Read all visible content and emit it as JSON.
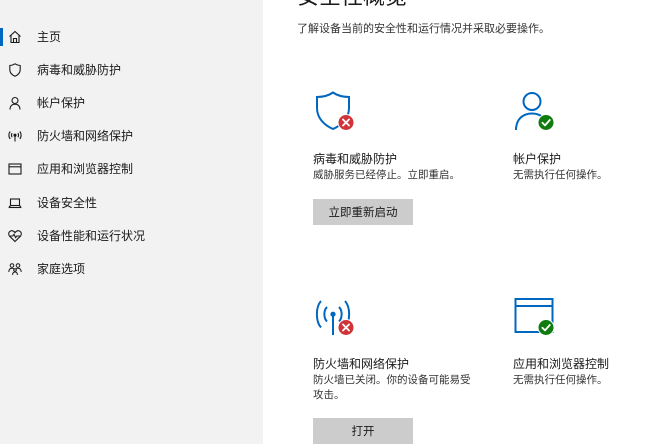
{
  "sidebar": {
    "items": [
      {
        "label": "主页",
        "icon": "home-icon",
        "selected": true
      },
      {
        "label": "病毒和威胁防护",
        "icon": "shield-icon"
      },
      {
        "label": "帐户保护",
        "icon": "person-icon"
      },
      {
        "label": "防火墙和网络保护",
        "icon": "wifi-antenna-icon"
      },
      {
        "label": "应用和浏览器控制",
        "icon": "browser-window-icon"
      },
      {
        "label": "设备安全性",
        "icon": "laptop-icon"
      },
      {
        "label": "设备性能和运行状况",
        "icon": "heart-pulse-icon"
      },
      {
        "label": "家庭选项",
        "icon": "family-icon"
      }
    ]
  },
  "main": {
    "title": "安全性概览",
    "subtitle": "了解设备当前的安全性和运行情况并采取必要操作。",
    "tiles": [
      {
        "title": "病毒和威胁防护",
        "desc": "威胁服务已经停止。立即重启。",
        "button": "立即重新启动",
        "icon": "shield-icon",
        "status": "error"
      },
      {
        "title": "帐户保护",
        "desc": "无需执行任何操作。",
        "icon": "person-icon",
        "status": "ok"
      },
      {
        "title": "防火墙和网络保护",
        "desc": "防火墙已关闭。你的设备可能易受攻击。",
        "button": "打开",
        "icon": "wifi-antenna-icon",
        "status": "error"
      },
      {
        "title": "应用和浏览器控制",
        "desc": "无需执行任何操作。",
        "icon": "browser-window-icon",
        "status": "ok"
      }
    ]
  },
  "colors": {
    "accent": "#0067c0",
    "error": "#d13438",
    "ok": "#107c10",
    "sidebar_bg": "#f2f2f2",
    "button_bg": "#cccccc"
  }
}
